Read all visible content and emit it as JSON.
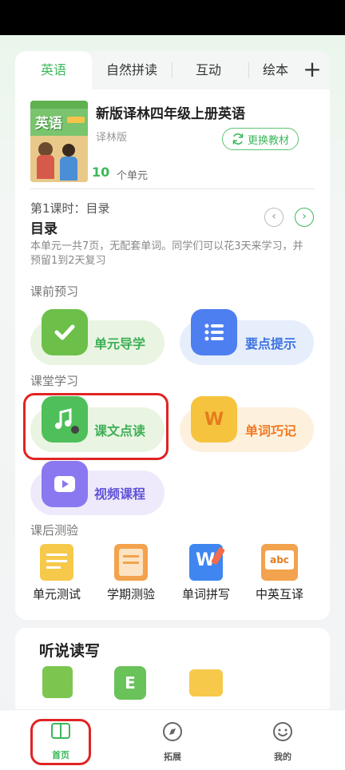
{
  "tabs": [
    "英语",
    "自然拼读",
    "互动",
    "绘本"
  ],
  "add_tab_icon": "plus-icon",
  "book": {
    "title": "新版译林四年级上册英语",
    "edition": "译林版",
    "switch_label": "更换教材",
    "cover_text": "英语",
    "unit_count": "10",
    "unit_label": "个单元"
  },
  "lesson": {
    "label": "第1课时：目录",
    "title": "目录",
    "description": "本单元一共7页，无配套单词。同学们可以花3天来学习，并预留1到2天复习"
  },
  "sections": {
    "preview": "课前预习",
    "classroom": "课堂学习",
    "after": "课后测验"
  },
  "preview_items": [
    "单元导学",
    "要点提示"
  ],
  "class_items": [
    "课文点读",
    "单词巧记",
    "视频课程"
  ],
  "test_items": [
    "单元测试",
    "学期测验",
    "单词拼写",
    "中英互译"
  ],
  "listening_title": "听说读写",
  "bottom_nav": [
    "首页",
    "拓展",
    "我的"
  ],
  "colors": {
    "accent": "#3cb85a",
    "highlight": "#e02424"
  }
}
